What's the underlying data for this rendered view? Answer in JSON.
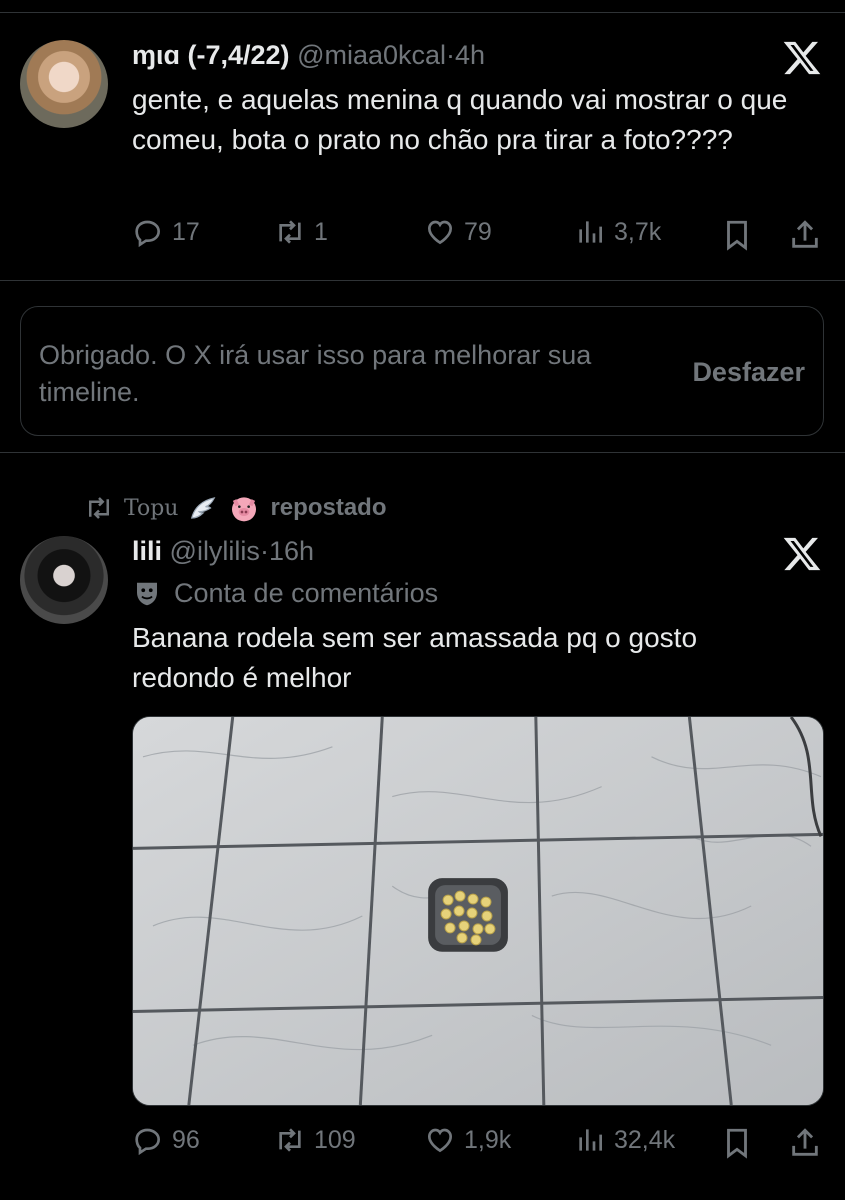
{
  "tweet1": {
    "display_name": "ɱιɑ (-7,4/22)",
    "handle": "@miaa0kcal",
    "dot": "·",
    "time": "4h",
    "text": "gente, e aquelas menina q quando vai mostrar o que comeu, bota o prato no chão pra tirar a foto????",
    "replies": "17",
    "reposts": "1",
    "likes": "79",
    "views": "3,7k"
  },
  "notice": {
    "text": "Obrigado. O X irá usar isso para melhorar sua timeline.",
    "undo_label": "Desfazer"
  },
  "repost_bar": {
    "reposter": "Topu",
    "label": "repostado"
  },
  "tweet2": {
    "display_name": "lili",
    "handle": "@ilylilis",
    "dot": "·",
    "time": "16h",
    "community_label": "Conta de comentários",
    "text": "Banana rodela sem ser amassada pq o gosto redondo é melhor",
    "replies": "96",
    "reposts": "109",
    "likes": "1,9k",
    "views": "32,4k"
  },
  "icons": {
    "reply": "reply-icon",
    "repost": "repost-icon",
    "like": "heart-icon",
    "views": "views-icon",
    "bookmark": "bookmark-icon",
    "share": "share-icon",
    "x_logo": "x-logo-icon"
  },
  "colors": {
    "background": "#000000",
    "text": "#e7e9ea",
    "muted": "#71767b",
    "border": "#2f3336"
  }
}
